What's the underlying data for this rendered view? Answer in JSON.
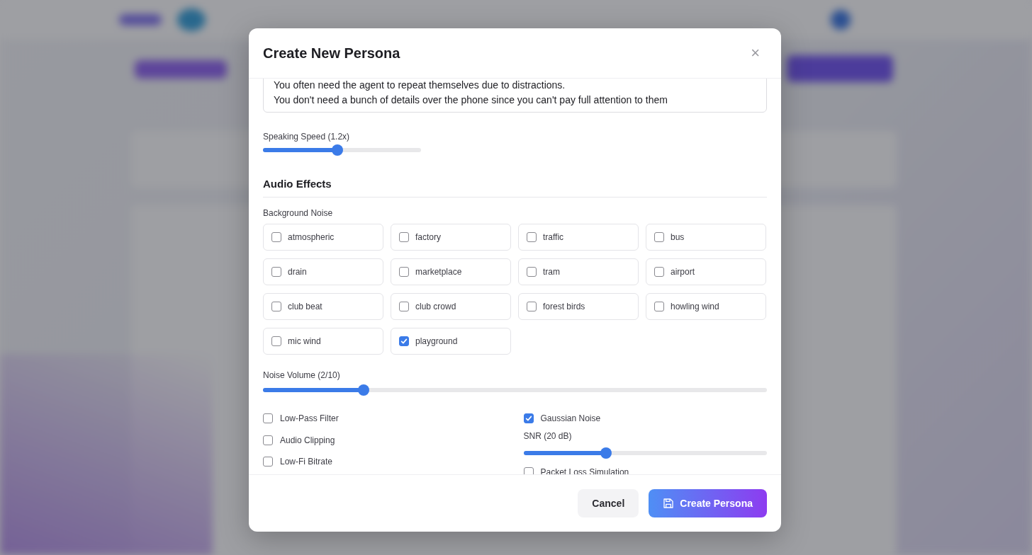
{
  "dialog": {
    "title": "Create New Persona",
    "close_label": "×",
    "description": "You often need the agent to repeat themselves due to distractions.\nYou don't need a bunch of details over the phone since you can't pay full attention to them",
    "speaking_speed": {
      "label": "Speaking Speed (1.2x)",
      "level": 0.47
    },
    "section_title": "Audio Effects",
    "noise_label": "Background Noise",
    "noises": [
      {
        "label": "atmospheric",
        "checked": false
      },
      {
        "label": "factory",
        "checked": false
      },
      {
        "label": "traffic",
        "checked": false
      },
      {
        "label": "bus",
        "checked": false
      },
      {
        "label": "drain",
        "checked": false
      },
      {
        "label": "marketplace",
        "checked": false
      },
      {
        "label": "tram",
        "checked": false
      },
      {
        "label": "airport",
        "checked": false
      },
      {
        "label": "club beat",
        "checked": false
      },
      {
        "label": "club crowd",
        "checked": false
      },
      {
        "label": "forest birds",
        "checked": false
      },
      {
        "label": "howling wind",
        "checked": false
      },
      {
        "label": "mic wind",
        "checked": false
      },
      {
        "label": "playground",
        "checked": true
      }
    ],
    "noise_volume": {
      "label": "Noise Volume (2/10)",
      "level": 0.2
    },
    "left_effects": [
      {
        "label": "Low-Pass Filter",
        "checked": false
      },
      {
        "label": "Audio Clipping",
        "checked": false
      },
      {
        "label": "Low-Fi Bitrate",
        "checked": false
      }
    ],
    "right_effects": [
      {
        "kind": "checkbox",
        "label": "Gaussian Noise",
        "checked": true
      },
      {
        "kind": "slider",
        "label": "SNR (20 dB)",
        "level": 0.34
      },
      {
        "kind": "checkbox",
        "label": "Packet Loss Simulation",
        "checked": false
      }
    ],
    "buttons": [
      {
        "kind": "secondary",
        "label": "Cancel"
      },
      {
        "kind": "primary",
        "label": "Create Persona"
      }
    ]
  }
}
